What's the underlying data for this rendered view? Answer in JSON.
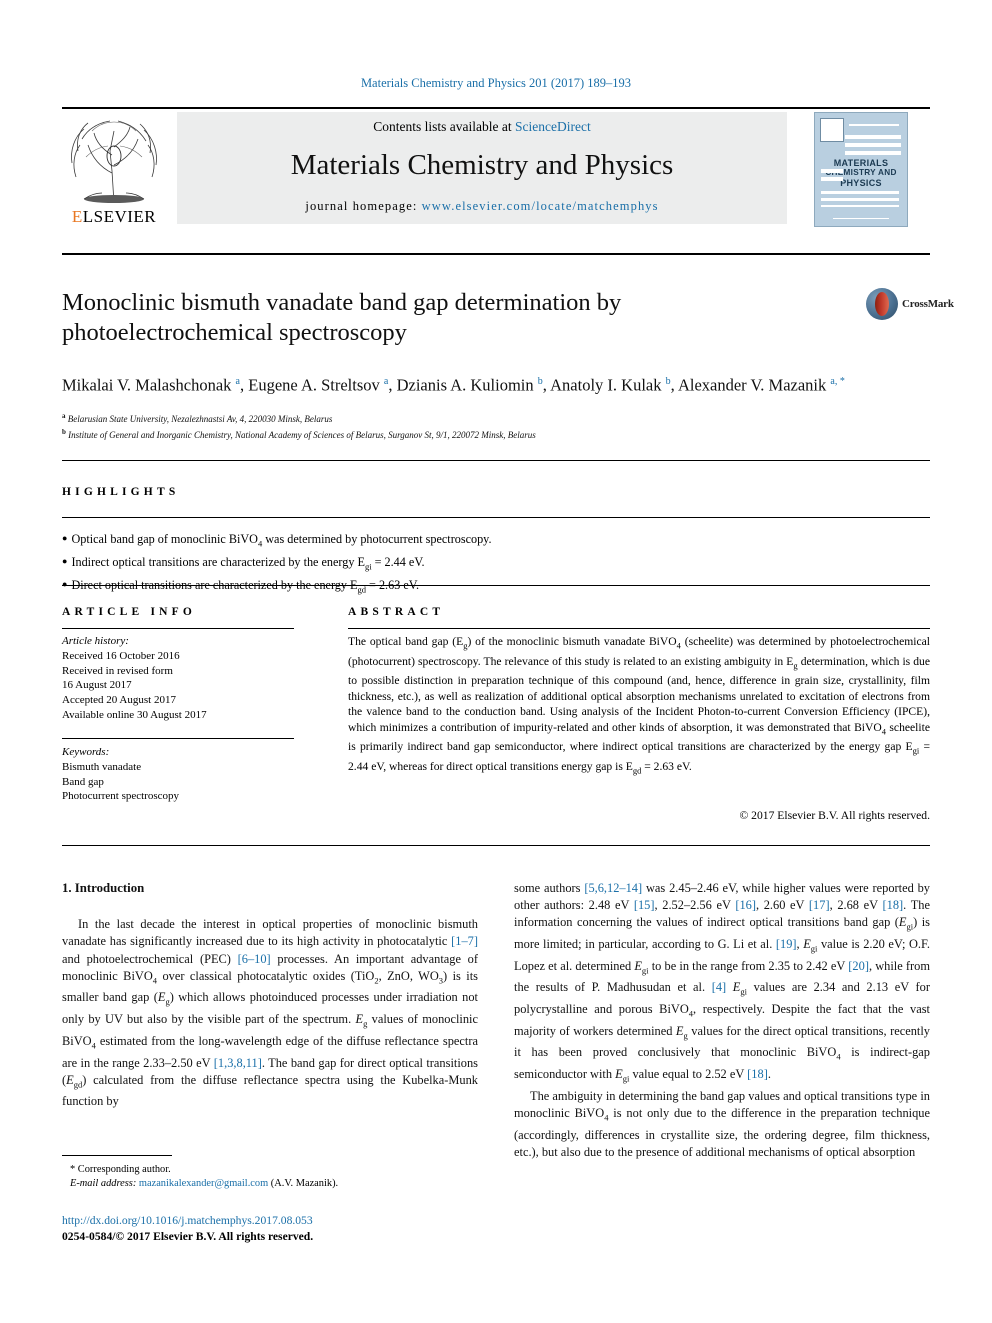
{
  "running_head": "Materials Chemistry and Physics 201 (2017) 189–193",
  "masthead": {
    "contents_prefix": "Contents lists available at ",
    "contents_link": "ScienceDirect",
    "journal_name": "Materials Chemistry and Physics",
    "homepage_label": "journal homepage: ",
    "homepage_url": "www.elsevier.com/locate/matchemphys",
    "publisher_logo_text": "ELSEVIER",
    "cover": {
      "line1": "MATERIALS",
      "line2": "CHEMISTRY AND",
      "line3": "PHYSICS"
    }
  },
  "article": {
    "title": "Monoclinic bismuth vanadate band gap determination by photoelectrochemical spectroscopy",
    "crossmark_label": "CrossMark",
    "authors_html": "Mikalai V. Malashchonak <sup class=\"sup\">a</sup>, Eugene A. Streltsov <sup class=\"sup\">a</sup>, Dzianis A. Kuliomin <sup class=\"sup\">b</sup>, Anatoly I. Kulak <sup class=\"sup\">b</sup>, Alexander V. Mazanik <sup class=\"sup\">a, *</sup>",
    "affiliations": [
      {
        "mark": "a",
        "text": "Belarusian State University, Nezalezhnastsi Av, 4, 220030 Minsk, Belarus"
      },
      {
        "mark": "b",
        "text": "Institute of General and Inorganic Chemistry, National Academy of Sciences of Belarus, Surganov St, 9/1, 220072 Minsk, Belarus"
      }
    ]
  },
  "highlights": {
    "heading": "HIGHLIGHTS",
    "items_html": [
      "Optical band gap of monoclinic BiVO<sub>4</sub> was determined by photocurrent spectroscopy.",
      "Indirect optical transitions are characterized by the energy E<sub>gi</sub> = 2.44 eV.",
      "Direct optical transitions are characterized by the energy E<sub>gd</sub> = 2.63 eV."
    ]
  },
  "article_info": {
    "heading": "ARTICLE INFO",
    "history_label": "Article history:",
    "history_lines": [
      "Received 16 October 2016",
      "Received in revised form",
      "16 August 2017",
      "Accepted 20 August 2017",
      "Available online 30 August 2017"
    ],
    "keywords_label": "Keywords:",
    "keywords": [
      "Bismuth vanadate",
      "Band gap",
      "Photocurrent spectroscopy"
    ]
  },
  "abstract": {
    "heading": "ABSTRACT",
    "text_html": "The optical band gap (E<sub>g</sub>) of the monoclinic bismuth vanadate BiVO<sub>4</sub> (scheelite) was determined by photoelectrochemical (photocurrent) spectroscopy. The relevance of this study is related to an existing ambiguity in E<sub>g</sub> determination, which is due to possible distinction in preparation technique of this compound (and, hence, difference in grain size, crystallinity, film thickness, etc.), as well as realization of additional optical absorption mechanisms unrelated to excitation of electrons from the valence band to the conduction band. Using analysis of the Incident Photon-to-current Conversion Efficiency (IPCE), which minimizes a contribution of impurity-related and other kinds of absorption, it was demonstrated that BiVO<sub>4</sub> scheelite is primarily indirect band gap semiconductor, where indirect optical transitions are characterized by the energy gap E<sub>gi</sub> = 2.44 eV, whereas for direct optical transitions energy gap is E<sub>gd</sub> = 2.63 eV.",
    "copyright": "© 2017 Elsevier B.V. All rights reserved."
  },
  "body": {
    "section_number_title": "1. Introduction",
    "left_paragraph_html": "In the last decade the interest in optical properties of monoclinic bismuth vanadate has significantly increased due to its high activity in photocatalytic <span class=\"ref\">[1–7]</span> and photoelectrochemical (PEC) <span class=\"ref\">[6–10]</span> processes. An important advantage of monoclinic BiVO<sub>4</sub> over classical photocatalytic oxides (TiO<sub>2</sub>, ZnO, WO<sub>3</sub>) is its smaller band gap (<i>E</i><sub>g</sub>) which allows photoinduced processes under irradiation not only by UV but also by the visible part of the spectrum. <i>E</i><sub>g</sub> values of monoclinic BiVO<sub>4</sub> estimated from the long-wavelength edge of the diffuse reflectance spectra are in the range 2.33–2.50 eV <span class=\"ref\">[1,3,8,11]</span>. The band gap for direct optical transitions (<i>E</i><sub>gd</sub>) calculated from the diffuse reflectance spectra using the Kubelka-Munk function by",
    "right_paragraph_1_html": "some authors <span class=\"ref\">[5,6,12–14]</span> was 2.45–2.46 eV, while higher values were reported by other authors: 2.48 eV <span class=\"ref\">[15]</span>, 2.52–2.56 eV <span class=\"ref\">[16]</span>, 2.60 eV <span class=\"ref\">[17]</span>, 2.68 eV <span class=\"ref\">[18]</span>. The information concerning the values of indirect optical transitions band gap (<i>E</i><sub>gi</sub>) is more limited; in particular, according to G. Li et al. <span class=\"ref\">[19]</span>, <i>E</i><sub>gi</sub> value is 2.20 eV; O.F. Lopez et al. determined <i>E</i><sub>gi</sub> to be in the range from 2.35 to 2.42 eV <span class=\"ref\">[20]</span>, while from the results of P. Madhusudan et al. <span class=\"ref\">[4]</span> <i>E</i><sub>gi</sub> values are 2.34 and 2.13 eV for polycrystalline and porous BiVO<sub>4</sub>, respectively. Despite the fact that the vast majority of workers determined <i>E</i><sub>g</sub> values for the direct optical transitions, recently it has been proved conclusively that monoclinic BiVO<sub>4</sub> is indirect-gap semiconductor with <i>E</i><sub>gi</sub> value equal to 2.52 eV <span class=\"ref\">[18]</span>.",
    "right_paragraph_2_html": "The ambiguity in determining the band gap values and optical transitions type in monoclinic BiVO<sub>4</sub> is not only due to the difference in the preparation technique (accordingly, differences in crystallite size, the ordering degree, film thickness, etc.), but also due to the presence of additional mechanisms of optical absorption"
  },
  "footer": {
    "corresponding_author": "* Corresponding author.",
    "email_label": "E-mail address:",
    "email": "mazanikalexander@gmail.com",
    "email_owner": "(A.V. Mazanik).",
    "doi": "http://dx.doi.org/10.1016/j.matchemphys.2017.08.053",
    "issn_line": "0254-0584/© 2017 Elsevier B.V. All rights reserved."
  },
  "colors": {
    "link": "#1a6fa8",
    "elsevier_orange": "#E87722",
    "band_gray": "#eceded",
    "cover_blue": "#b9cfe0"
  }
}
